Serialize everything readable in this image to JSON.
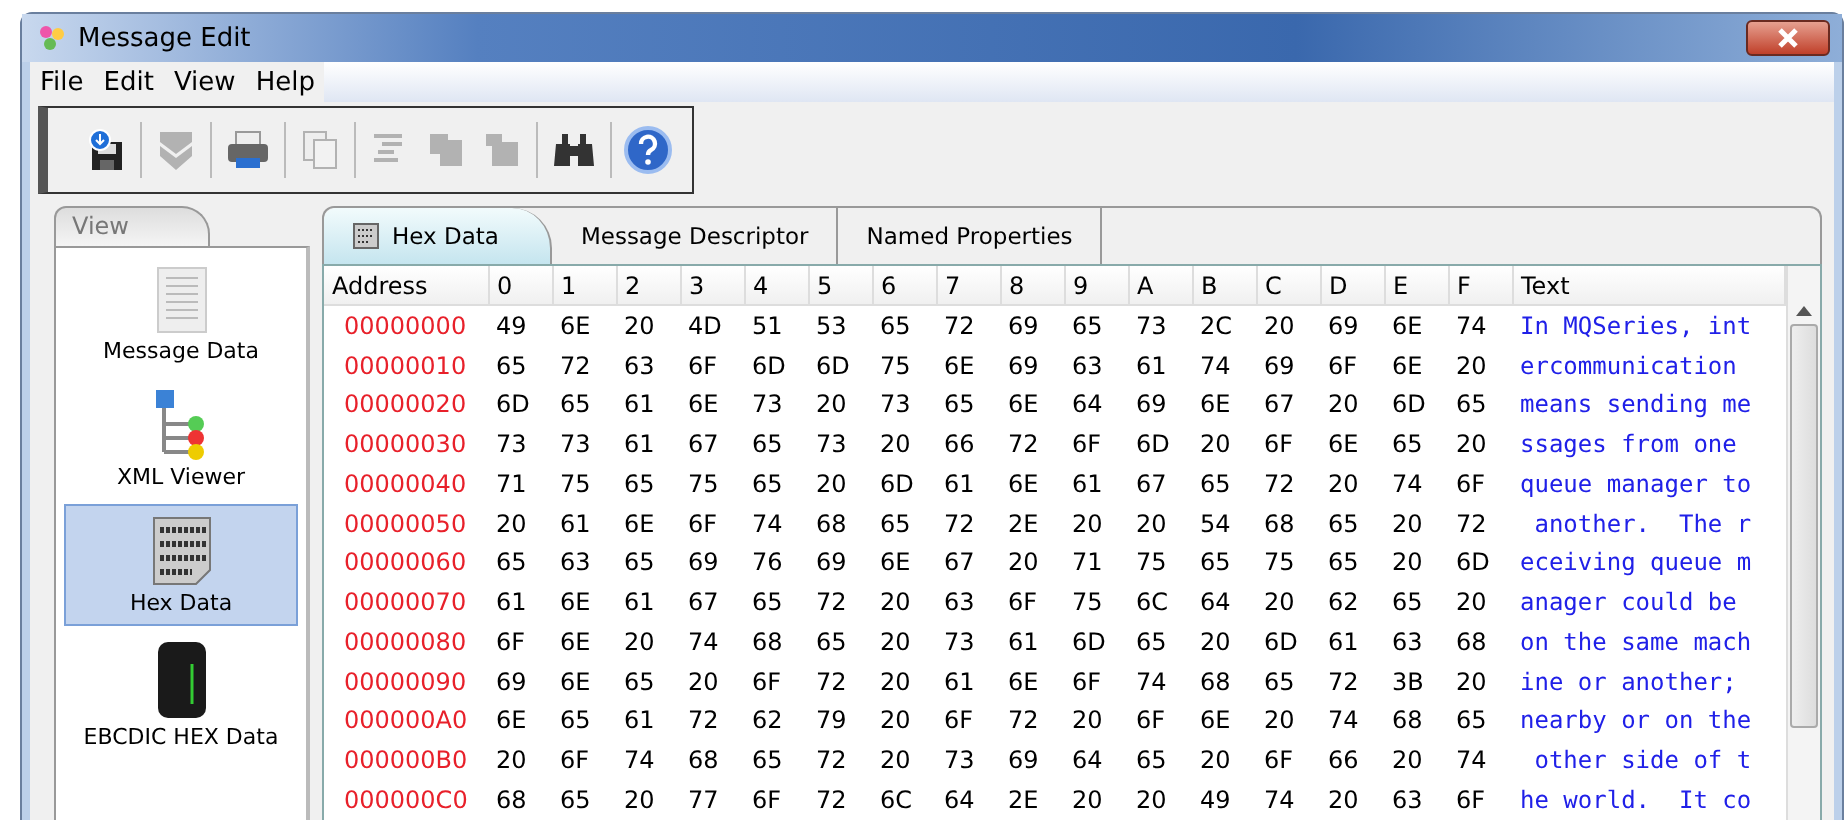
{
  "window": {
    "title": "Message Edit"
  },
  "menu": [
    "File",
    "Edit",
    "View",
    "Help"
  ],
  "toolbar": [
    {
      "kind": "save",
      "disabled": false
    },
    {
      "kind": "sep"
    },
    {
      "kind": "down",
      "disabled": true
    },
    {
      "kind": "sep"
    },
    {
      "kind": "print",
      "disabled": false
    },
    {
      "kind": "sep"
    },
    {
      "kind": "copy",
      "disabled": true
    },
    {
      "kind": "sep"
    },
    {
      "kind": "align",
      "disabled": true
    },
    {
      "kind": "shape",
      "disabled": true
    },
    {
      "kind": "shape2",
      "disabled": true
    },
    {
      "kind": "sep"
    },
    {
      "kind": "find",
      "disabled": false
    },
    {
      "kind": "sep"
    },
    {
      "kind": "help",
      "disabled": false
    }
  ],
  "sidebar": {
    "title": "View",
    "items": [
      {
        "kind": "doc",
        "label": "Message Data",
        "selected": false
      },
      {
        "kind": "tree",
        "label": "XML Viewer",
        "selected": false
      },
      {
        "kind": "hex",
        "label": "Hex Data",
        "selected": true
      },
      {
        "kind": "server",
        "label": "EBCDIC HEX Data",
        "selected": false
      }
    ]
  },
  "tabs": [
    {
      "label": "Hex Data",
      "selected": true,
      "icon": true
    },
    {
      "label": "Message Descriptor",
      "selected": false,
      "icon": false
    },
    {
      "label": "Named Properties",
      "selected": false,
      "icon": false
    }
  ],
  "table": {
    "columns": [
      "Address",
      "0",
      "1",
      "2",
      "3",
      "4",
      "5",
      "6",
      "7",
      "8",
      "9",
      "A",
      "B",
      "C",
      "D",
      "E",
      "F",
      "Text"
    ],
    "rows": [
      {
        "address": "00000000",
        "bytes": [
          "49",
          "6E",
          "20",
          "4D",
          "51",
          "53",
          "65",
          "72",
          "69",
          "65",
          "73",
          "2C",
          "20",
          "69",
          "6E",
          "74"
        ],
        "text": "In MQSeries, int"
      },
      {
        "address": "00000010",
        "bytes": [
          "65",
          "72",
          "63",
          "6F",
          "6D",
          "6D",
          "75",
          "6E",
          "69",
          "63",
          "61",
          "74",
          "69",
          "6F",
          "6E",
          "20"
        ],
        "text": "ercommunication "
      },
      {
        "address": "00000020",
        "bytes": [
          "6D",
          "65",
          "61",
          "6E",
          "73",
          "20",
          "73",
          "65",
          "6E",
          "64",
          "69",
          "6E",
          "67",
          "20",
          "6D",
          "65"
        ],
        "text": "means sending me"
      },
      {
        "address": "00000030",
        "bytes": [
          "73",
          "73",
          "61",
          "67",
          "65",
          "73",
          "20",
          "66",
          "72",
          "6F",
          "6D",
          "20",
          "6F",
          "6E",
          "65",
          "20"
        ],
        "text": "ssages from one "
      },
      {
        "address": "00000040",
        "bytes": [
          "71",
          "75",
          "65",
          "75",
          "65",
          "20",
          "6D",
          "61",
          "6E",
          "61",
          "67",
          "65",
          "72",
          "20",
          "74",
          "6F"
        ],
        "text": "queue manager to"
      },
      {
        "address": "00000050",
        "bytes": [
          "20",
          "61",
          "6E",
          "6F",
          "74",
          "68",
          "65",
          "72",
          "2E",
          "20",
          "20",
          "54",
          "68",
          "65",
          "20",
          "72"
        ],
        "text": " another.  The r"
      },
      {
        "address": "00000060",
        "bytes": [
          "65",
          "63",
          "65",
          "69",
          "76",
          "69",
          "6E",
          "67",
          "20",
          "71",
          "75",
          "65",
          "75",
          "65",
          "20",
          "6D"
        ],
        "text": "eceiving queue m"
      },
      {
        "address": "00000070",
        "bytes": [
          "61",
          "6E",
          "61",
          "67",
          "65",
          "72",
          "20",
          "63",
          "6F",
          "75",
          "6C",
          "64",
          "20",
          "62",
          "65",
          "20"
        ],
        "text": "anager could be "
      },
      {
        "address": "00000080",
        "bytes": [
          "6F",
          "6E",
          "20",
          "74",
          "68",
          "65",
          "20",
          "73",
          "61",
          "6D",
          "65",
          "20",
          "6D",
          "61",
          "63",
          "68"
        ],
        "text": "on the same mach"
      },
      {
        "address": "00000090",
        "bytes": [
          "69",
          "6E",
          "65",
          "20",
          "6F",
          "72",
          "20",
          "61",
          "6E",
          "6F",
          "74",
          "68",
          "65",
          "72",
          "3B",
          "20"
        ],
        "text": "ine or another; "
      },
      {
        "address": "000000A0",
        "bytes": [
          "6E",
          "65",
          "61",
          "72",
          "62",
          "79",
          "20",
          "6F",
          "72",
          "20",
          "6F",
          "6E",
          "20",
          "74",
          "68",
          "65"
        ],
        "text": "nearby or on the"
      },
      {
        "address": "000000B0",
        "bytes": [
          "20",
          "6F",
          "74",
          "68",
          "65",
          "72",
          "20",
          "73",
          "69",
          "64",
          "65",
          "20",
          "6F",
          "66",
          "20",
          "74"
        ],
        "text": " other side of t"
      },
      {
        "address": "000000C0",
        "bytes": [
          "68",
          "65",
          "20",
          "77",
          "6F",
          "72",
          "6C",
          "64",
          "2E",
          "20",
          "20",
          "49",
          "74",
          "20",
          "63",
          "6F"
        ],
        "text": "he world.  It co"
      }
    ]
  }
}
